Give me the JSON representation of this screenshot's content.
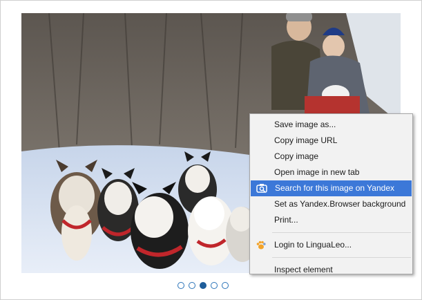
{
  "image": {
    "description_icon": "photo"
  },
  "carousel": {
    "dot_count": 5,
    "active_index": 2
  },
  "context_menu": {
    "items": [
      {
        "label": "Save image as..."
      },
      {
        "label": "Copy image URL"
      },
      {
        "label": "Copy image"
      },
      {
        "label": "Open image in new tab"
      },
      {
        "label": "Search for this image on Yandex",
        "icon": "camera-search-icon",
        "highlighted": true
      },
      {
        "label": "Set as Yandex.Browser background"
      },
      {
        "label": "Print..."
      },
      {
        "label": "Login to LinguaLeo...",
        "icon": "lingualeo-paw-icon"
      },
      {
        "label": "Inspect element"
      }
    ],
    "highlight_color": "#3c78d8"
  }
}
